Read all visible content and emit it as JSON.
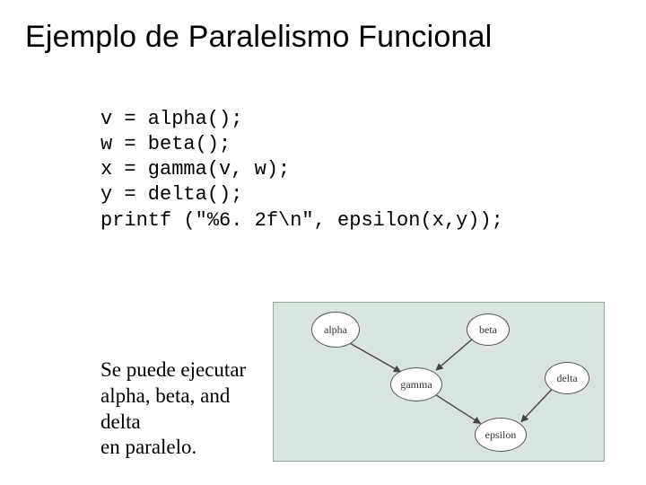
{
  "title": "Ejemplo de Paralelismo Funcional",
  "code": {
    "l1": "v = alpha();",
    "l2": "w = beta();",
    "l3": "x = gamma(v, w);",
    "l4": "y = delta();",
    "l5": "printf (\"%6. 2f\\n\", epsilon(x,y));"
  },
  "note": {
    "l1": "Se puede ejecutar",
    "l2": "alpha, beta, and delta",
    "l3": "en paralelo."
  },
  "graph": {
    "nodes": {
      "alpha": "alpha",
      "beta": "beta",
      "gamma": "gamma",
      "delta": "delta",
      "epsilon": "epsilon"
    }
  }
}
